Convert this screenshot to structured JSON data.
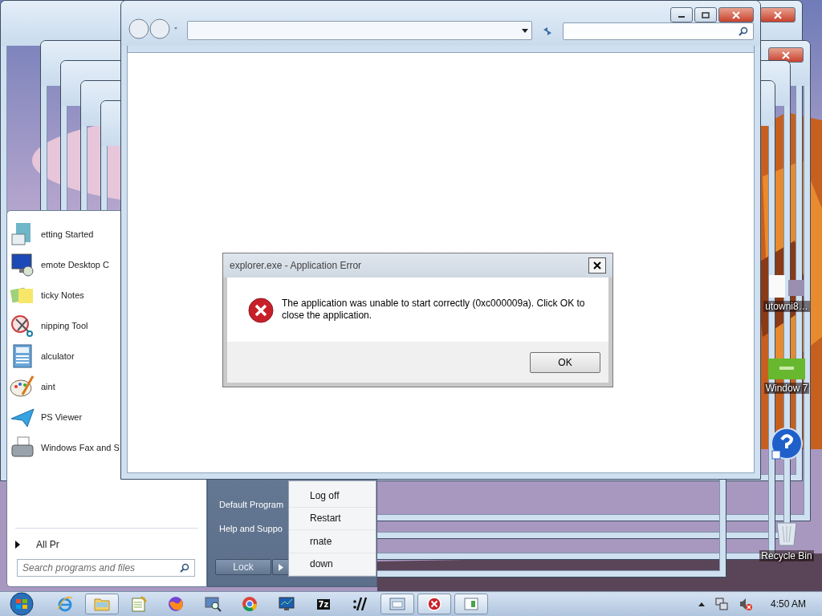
{
  "desktop_icons": [
    {
      "kind": "thumb-white",
      "label": "utowni8…"
    },
    {
      "kind": "thumb-green",
      "label": "Window 7"
    },
    {
      "kind": "help"
    },
    {
      "kind": "recycle",
      "label": "Recycle Bin"
    }
  ],
  "start_menu": {
    "programs": [
      {
        "kind": "document",
        "label": "etting Started"
      },
      {
        "kind": "monitor",
        "label": "emote Desktop C"
      },
      {
        "kind": "notes",
        "label": "ticky Notes"
      },
      {
        "kind": "scissors",
        "label": "nipping Tool"
      },
      {
        "kind": "calculator",
        "label": "alculator"
      },
      {
        "kind": "palette",
        "label": "aint"
      },
      {
        "kind": "plane",
        "label": "PS Viewer"
      },
      {
        "kind": "fax",
        "label": "Windows Fax and S"
      }
    ],
    "all_programs": "All Pr",
    "search": {
      "placeholder": "Search programs and files"
    },
    "links": [
      "Default Program",
      "Help and Suppo"
    ],
    "lock_button": "Lock",
    "shutdown_menu": [
      "Log off",
      "Restart",
      "rnate",
      "down"
    ]
  },
  "dialog": {
    "title": "explorer.exe - Application Error",
    "message": "The application was unable to start correctly (0xc000009a). Click OK to close the application.",
    "buttons": [
      "OK"
    ]
  },
  "taskbar": {
    "items": [
      {
        "kind": "ie",
        "open": false
      },
      {
        "kind": "folder",
        "open": true
      },
      {
        "kind": "notepad",
        "open": false
      },
      {
        "kind": "firefox",
        "open": false
      },
      {
        "kind": "magnifier",
        "open": false
      },
      {
        "kind": "chrome",
        "open": false
      },
      {
        "kind": "monitor",
        "open": false
      },
      {
        "kind": "archive",
        "label": "7z",
        "open": false
      },
      {
        "kind": "slashes",
        "open": false
      },
      {
        "kind": "window",
        "open": true
      },
      {
        "kind": "error",
        "open": true
      },
      {
        "kind": "panel",
        "open": true
      }
    ],
    "clock": "4:50 AM"
  }
}
